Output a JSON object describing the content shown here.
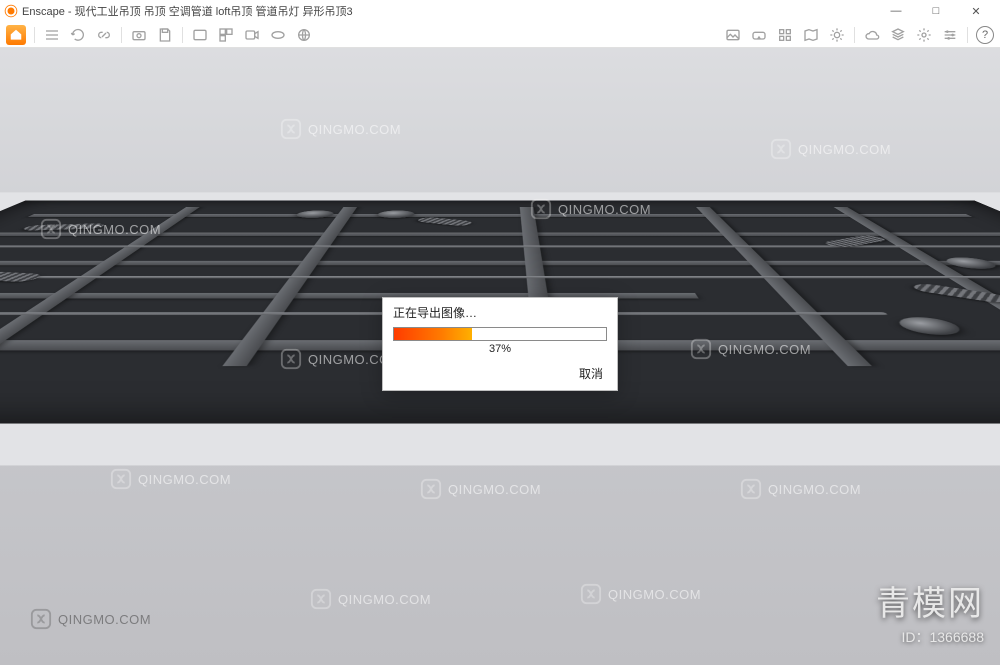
{
  "app": {
    "name": "Enscape",
    "title": "Enscape - 现代工业吊顶 吊顶 空调管道 loft吊顶 管道吊灯 异形吊顶3"
  },
  "window_controls": {
    "min": "—",
    "max": "□",
    "close": "✕"
  },
  "toolbar": {
    "home": "home-icon",
    "menu": "menu-icon",
    "display": "display-icon",
    "assets": "assets-icon",
    "save": "save-icon",
    "cloud": "cloud-icon",
    "video": "video-icon",
    "views": "views-icon",
    "panorama": "panorama-icon",
    "vr": "vr-icon",
    "sun": "sun-icon",
    "photo": "photo-icon",
    "settings": "settings-icon",
    "layers": "layers-icon",
    "info": "info-icon",
    "help": "?"
  },
  "dialog": {
    "title": "正在导出图像…",
    "percent_value": 37,
    "percent_label": "37%",
    "cancel_label": "取消"
  },
  "watermark": {
    "text": "QINGMO.COM",
    "logo_cn": "青模网",
    "id_label": "ID：1366688"
  },
  "colors": {
    "accent_start": "#ff3c00",
    "accent_end": "#ffb000",
    "app_badge": "#ff7a00"
  }
}
